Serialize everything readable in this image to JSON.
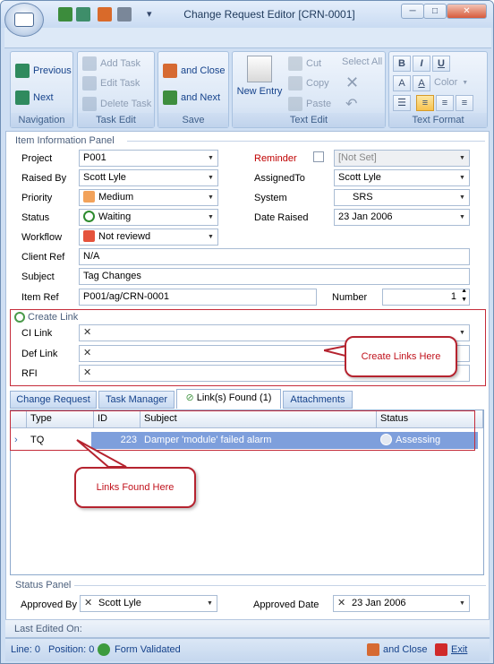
{
  "window": {
    "title": "Change Request Editor [CRN-0001]",
    "minimize": "─",
    "maximize": "□",
    "close": "✕"
  },
  "qat": {
    "more": "▾"
  },
  "ribbon": {
    "navigation": {
      "label": "Navigation",
      "previous": "Previous",
      "next": "Next"
    },
    "task_edit": {
      "label": "Task Edit",
      "add": "Add Task",
      "edit": "Edit Task",
      "delete": "Delete Task"
    },
    "save": {
      "label": "Save",
      "close": "and Close",
      "new": "and Next"
    },
    "text_edit": {
      "label": "Text Edit",
      "new_entry": "New Entry",
      "cut": "Cut",
      "copy": "Copy",
      "paste": "Paste",
      "select_all": "Select All"
    },
    "text_format": {
      "label": "Text Format",
      "bold": "B",
      "italic": "I",
      "underline": "U",
      "color": "Color"
    }
  },
  "item_panel": {
    "title": "Item Information Panel",
    "project": {
      "label": "Project",
      "value": "P001"
    },
    "raised_by": {
      "label": "Raised By",
      "value": "Scott Lyle"
    },
    "priority": {
      "label": "Priority",
      "value": "Medium"
    },
    "status": {
      "label": "Status",
      "value": "Waiting"
    },
    "workflow": {
      "label": "Workflow",
      "value": "Not reviewd"
    },
    "client_ref": {
      "label": "Client Ref",
      "value": "N/A"
    },
    "subject": {
      "label": "Subject",
      "value": "Tag Changes"
    },
    "item_ref": {
      "label": "Item Ref",
      "value": "P001/ag/CRN-0001"
    },
    "reminder": {
      "label": "Reminder",
      "value": "[Not Set]"
    },
    "assigned_to": {
      "label": "AssignedTo",
      "value": "Scott Lyle"
    },
    "system": {
      "label": "System",
      "value": "SRS"
    },
    "date_raised": {
      "label": "Date Raised",
      "value": "23 Jan 2006"
    },
    "number": {
      "label": "Number",
      "value": "1"
    }
  },
  "create_link": {
    "title": "Create Link",
    "ci_link": {
      "label": "CI Link"
    },
    "def_link": {
      "label": "Def Link"
    },
    "rfi": {
      "label": "RFI"
    },
    "callout": "Create Links Here"
  },
  "tabs": [
    "Change Request",
    "Task Manager",
    "Link(s) Found (1)",
    "Attachments"
  ],
  "grid": {
    "columns": [
      "Type",
      "ID",
      "Subject",
      "Status"
    ],
    "rows": [
      {
        "type": "TQ",
        "id": "223",
        "subject": "Damper 'module' failed alarm",
        "status": "Assessing"
      }
    ],
    "callout": "Links Found Here"
  },
  "status_panel": {
    "title": "Status Panel",
    "approved_by": {
      "label": "Approved By",
      "value": "Scott Lyle"
    },
    "approved_date": {
      "label": "Approved Date",
      "value": "23 Jan 2006"
    }
  },
  "last_edited": "Last Edited On:",
  "statusbar": {
    "line": "Line: 0",
    "position": "Position: 0",
    "validated": "Form Validated",
    "close": "and Close",
    "exit": "Exit"
  },
  "colors": {
    "accent": "#15428b",
    "highlight": "#7e9fdc",
    "callout": "#c0121c"
  }
}
